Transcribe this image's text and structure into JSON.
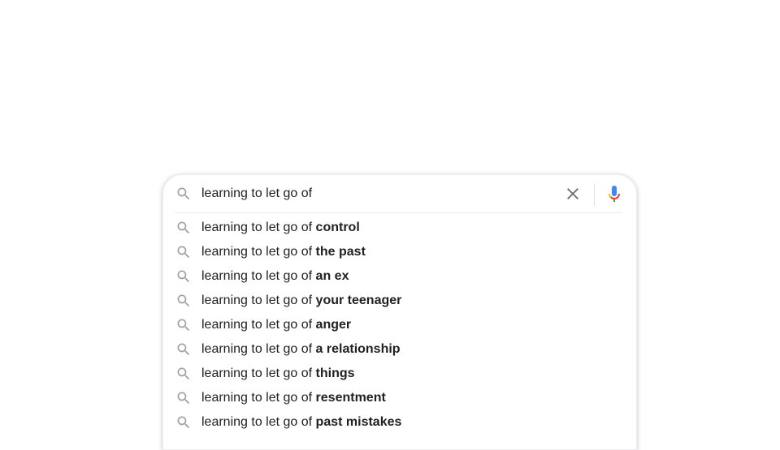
{
  "search": {
    "query": "learning to let go of",
    "clear_icon": "close-icon",
    "mic_icon": "microphone-icon",
    "search_icon": "search-icon"
  },
  "suggestions": [
    {
      "prefix": "learning to let go of",
      "completion": "control"
    },
    {
      "prefix": "learning to let go of",
      "completion": "the past"
    },
    {
      "prefix": "learning to let go of",
      "completion": "an ex"
    },
    {
      "prefix": "learning to let go of",
      "completion": "your teenager"
    },
    {
      "prefix": "learning to let go of",
      "completion": "anger"
    },
    {
      "prefix": "learning to let go of",
      "completion": "a relationship"
    },
    {
      "prefix": "learning to let go of",
      "completion": "things"
    },
    {
      "prefix": "learning to let go of",
      "completion": "resentment"
    },
    {
      "prefix": "learning to let go of",
      "completion": "past mistakes"
    }
  ],
  "colors": {
    "text": "#202124",
    "icon_gray": "#9aa0a6",
    "mic_blue": "#4285f4",
    "mic_red": "#ea4335",
    "mic_yellow": "#fbbc04",
    "mic_green": "#34a853"
  }
}
